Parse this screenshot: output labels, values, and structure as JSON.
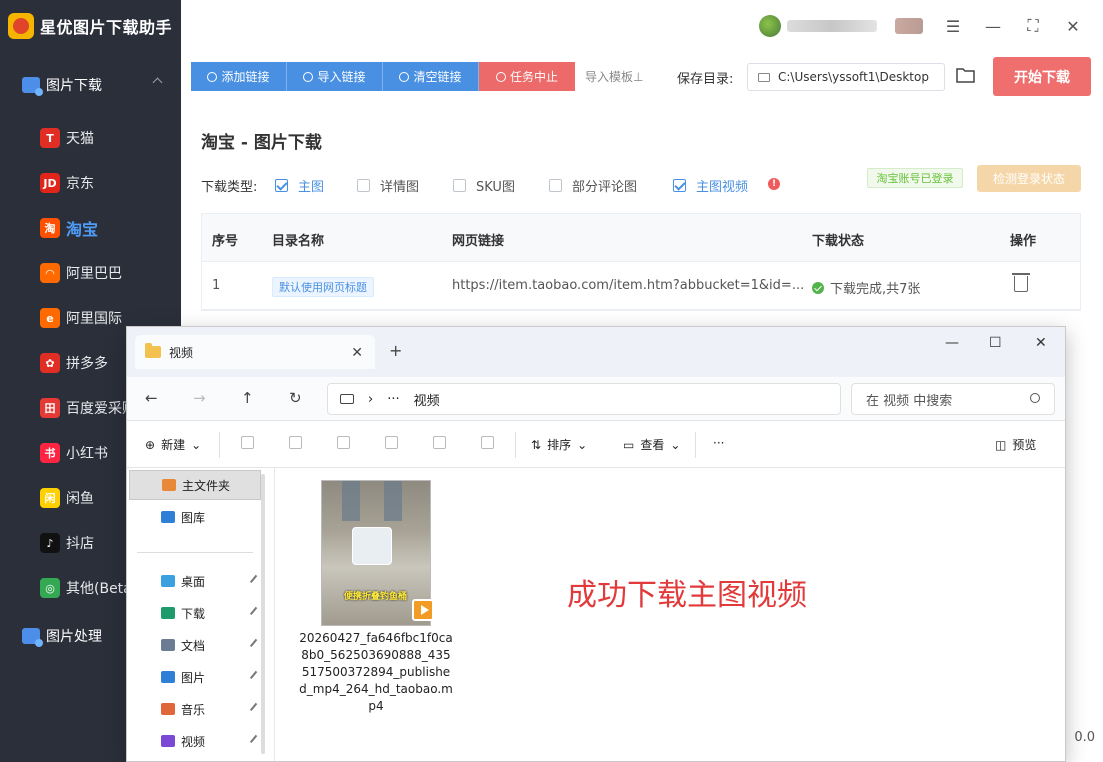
{
  "app": {
    "title": "星优图片下载助手"
  },
  "sidebar": {
    "group_download": "图片下载",
    "items": [
      {
        "label": "天猫",
        "icon": "tmall-icon",
        "color": "#e02e24",
        "glyph": "T"
      },
      {
        "label": "京东",
        "icon": "jd-icon",
        "color": "#e1251b",
        "glyph": "JD"
      },
      {
        "label": "淘宝",
        "icon": "taobao-icon",
        "color": "#ff5000",
        "glyph": "淘"
      },
      {
        "label": "阿里巴巴",
        "icon": "alibaba-icon",
        "color": "#ff6a00",
        "glyph": "◠"
      },
      {
        "label": "阿里国际",
        "icon": "alibaba-intl-icon",
        "color": "#ff6a00",
        "glyph": "e"
      },
      {
        "label": "拼多多",
        "icon": "pinduoduo-icon",
        "color": "#e02e24",
        "glyph": "✿"
      },
      {
        "label": "百度爱采购",
        "icon": "baidu-icon",
        "color": "#e53935",
        "glyph": "田"
      },
      {
        "label": "小红书",
        "icon": "xiaohongshu-icon",
        "color": "#ff2442",
        "glyph": "书"
      },
      {
        "label": "闲鱼",
        "icon": "xianyu-icon",
        "color": "#ffd000",
        "glyph": "闲"
      },
      {
        "label": "抖店",
        "icon": "douyin-icon",
        "color": "#111111",
        "glyph": "♪"
      },
      {
        "label": "其他(Beta)",
        "icon": "chrome-icon",
        "color": "#34a853",
        "glyph": "◎"
      }
    ],
    "active_index": 2,
    "group_process": "图片处理"
  },
  "toolbar": {
    "add_link": "添加链接",
    "import_link": "导入链接",
    "clear_link": "清空链接",
    "stop_task": "任务中止",
    "import_template": "导入模板⊥",
    "save_dir_label": "保存目录:",
    "save_dir_value": "C:\\Users\\yssoft1\\Desktop",
    "start_download": "开始下载"
  },
  "page": {
    "title": "淘宝 - 图片下载",
    "download_type_label": "下载类型:",
    "options": [
      {
        "label": "主图",
        "checked": true
      },
      {
        "label": "详情图",
        "checked": false
      },
      {
        "label": "SKU图",
        "checked": false
      },
      {
        "label": "部分评论图",
        "checked": false
      },
      {
        "label": "主图视频",
        "checked": true
      }
    ],
    "logged_in_badge": "淘宝账号已登录",
    "check_login_button": "检测登录状态"
  },
  "table": {
    "headers": [
      "序号",
      "目录名称",
      "网页链接",
      "下载状态",
      "操作"
    ],
    "rows": [
      {
        "index": "1",
        "dir": "默认使用网页标题",
        "url": "https://item.taobao.com/item.htm?abbucket=1&id=...",
        "status": "下载完成,共7张"
      }
    ]
  },
  "version_fragment": "0.0",
  "explorer": {
    "tab_title": "视频",
    "breadcrumb": "视频",
    "search_placeholder": "在 视频 中搜索",
    "cmd": {
      "new": "新建",
      "sort": "排序",
      "view": "查看",
      "more": "···",
      "preview": "预览"
    },
    "nav": [
      {
        "label": "主文件夹",
        "icon": "home-icon",
        "color": "#e8893a",
        "pinned": false,
        "selected": true
      },
      {
        "label": "图库",
        "icon": "gallery-icon",
        "color": "#2f7fd6",
        "pinned": false,
        "selected": false
      },
      {
        "label": "桌面",
        "icon": "desktop-icon",
        "color": "#3aa0e0",
        "pinned": true,
        "selected": false
      },
      {
        "label": "下载",
        "icon": "download-icon",
        "color": "#1f9a6b",
        "pinned": true,
        "selected": false
      },
      {
        "label": "文档",
        "icon": "document-icon",
        "color": "#6b7c93",
        "pinned": true,
        "selected": false
      },
      {
        "label": "图片",
        "icon": "pictures-icon",
        "color": "#2f7fd6",
        "pinned": true,
        "selected": false
      },
      {
        "label": "音乐",
        "icon": "music-icon",
        "color": "#e0673a",
        "pinned": true,
        "selected": false
      },
      {
        "label": "视频",
        "icon": "videos-icon",
        "color": "#7a4ad6",
        "pinned": true,
        "selected": false
      }
    ],
    "file": {
      "name": "20260427_fa646fbc1f0ca8b0_562503690888_435517500372894_published_mp4_264_hd_taobao.mp4",
      "thumb_caption": "便携折叠钓鱼桶"
    },
    "annotation": "成功下载主图视频"
  }
}
